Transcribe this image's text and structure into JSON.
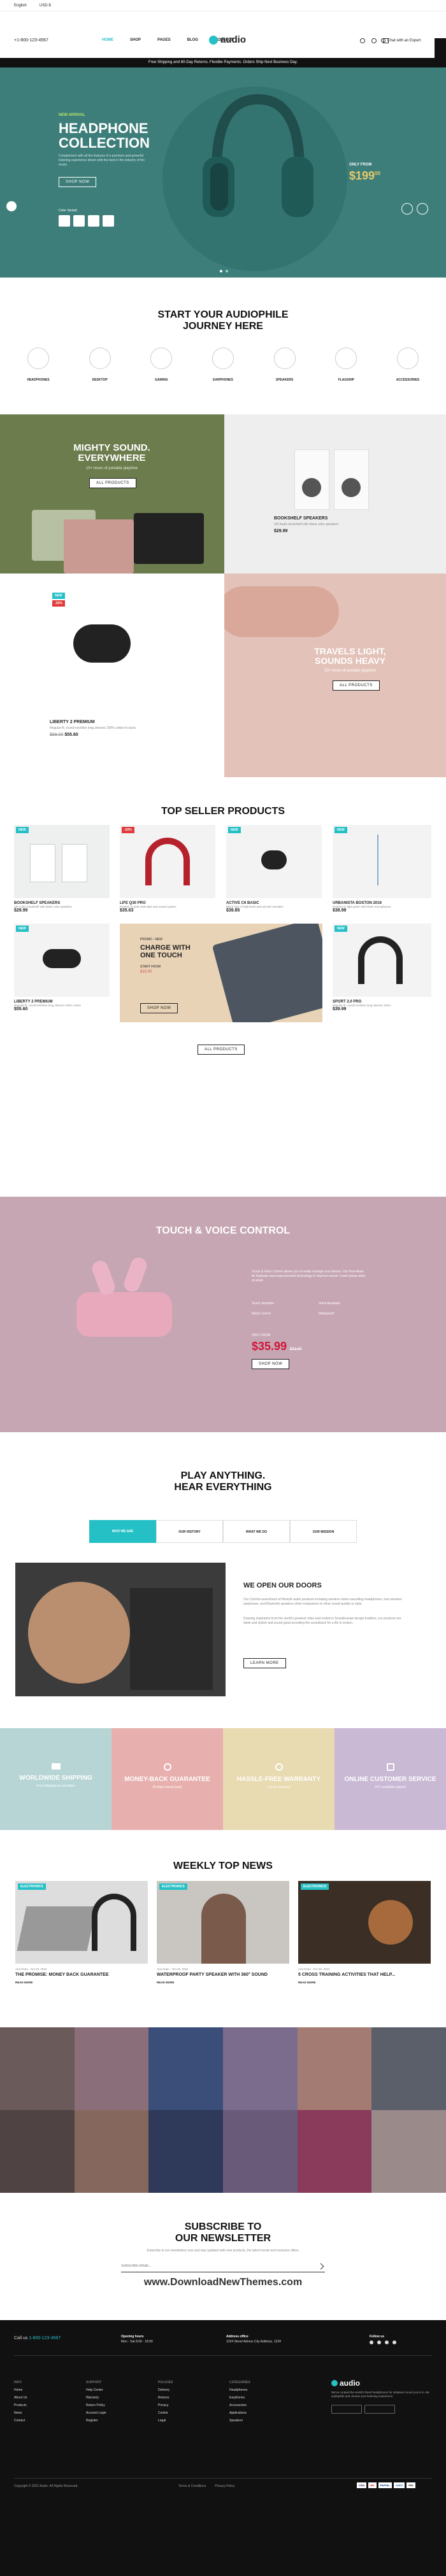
{
  "topbar": {
    "lang": "English",
    "currency": "USD $",
    "phone": "+1-800-123-4567",
    "chat": "Chat with an Expert"
  },
  "nav": {
    "items": [
      "HOME",
      "SHOP",
      "PAGES",
      "BLOG",
      "CONTACT"
    ],
    "logo": "audio"
  },
  "promo": "Free Shipping and 60-Day Returns. Flexible Payments. Orders Ship Next Business Day.",
  "hero": {
    "tag": "NEW ARRIVAL",
    "title_line1": "HEADPHONE",
    "title_line2": "COLLECTION",
    "desc": "Complement with all the features of a premium and powerful listening experience driven with the best in the industry of the music.",
    "cta": "SHOP NOW",
    "colors_label": "Color Variant",
    "price_label": "ONLY FROM",
    "price": "$199",
    "price_sup": "00"
  },
  "journey": {
    "title_line1": "START YOUR AUDIOPHILE",
    "title_line2": "JOURNEY HERE",
    "items": [
      "HEADPHONES",
      "DESKTOP",
      "GAMING",
      "EARPHONES",
      "SPEAKERS",
      "FLAGSHIP",
      "ACCESSORIES"
    ]
  },
  "banners": {
    "mighty": {
      "title_line1": "MIGHTY SOUND.",
      "title_line2": "EVERYWHERE",
      "sub": "10+ hours of portable playtime",
      "cta": "ALL PRODUCTS"
    },
    "bookshelf": {
      "name": "BOOKSHELF SPEAKERS",
      "desc": "UR Audio bookshelf with black color speakers",
      "price": "$29.99"
    },
    "liberty": {
      "badge_new": "NEW",
      "badge_sale": "-20%",
      "name": "LIBERTY 2 PREMIUM",
      "desc": "Regular fit, round-neckline long sleeves 100% cotton to sizes.",
      "old_price": "$69.00",
      "price": "$55.60"
    },
    "travels": {
      "title_line1": "TRAVELS LIGHT,",
      "title_line2": "SOUNDS HEAVY",
      "sub": "20+ hours of portable playtime",
      "cta": "ALL PRODUCTS"
    }
  },
  "top_seller": {
    "title": "TOP SELLER PRODUCTS",
    "products": [
      {
        "name": "BOOKSHELF SPEAKERS",
        "desc": "UR Audio bookshelf with black color speakers",
        "price": "$29.99",
        "badge": "NEW"
      },
      {
        "name": "LIFE Q30 PRO",
        "desc": "Printed on gold matt style and sound system",
        "price": "$35.63",
        "badge": "-20%"
      },
      {
        "name": "ACTIVE C6 BASIC",
        "desc": "Black type of high-level and smooth sensitive",
        "price": "$39.85",
        "badge": "NEW"
      },
      {
        "name": "URBANISTA BOSTON 2016",
        "desc": "Portland in light green with three microphones",
        "price": "$38.99",
        "badge": "NEW"
      },
      {
        "name": "LIBERTY 2 PREMIUM",
        "desc": "Regular fit, round-neckline long sleeves 100% cotton",
        "price": "$55.60",
        "badge": "NEW"
      },
      {
        "name": "SPORT 2.0 PRO",
        "desc": "Regular fit, round-neckline long sleeves 100%",
        "price": "$39.99",
        "badge": "NEW"
      }
    ],
    "charge": {
      "title_line1": "CHARGE WITH",
      "title_line2": "ONE TOUCH",
      "tag": "PROMO - NEW",
      "price_label": "START FROM",
      "price": "$15.00",
      "cta": "SHOP NOW"
    },
    "cta": "ALL PRODUCTS"
  },
  "touch": {
    "title": "TOUCH & VOICE CONTROL",
    "desc": "Touch & Voice Control allows you to easily manage your device. Our Pure-Bass for Earbuds uses bass-boosted technology to improve sound. Lorem ipsum dolor sit amet.",
    "features": [
      "Touch Sensitive",
      "Voice Assistant",
      "Noise Cancel",
      "Waterproof"
    ],
    "price_label": "ONLY FROM",
    "price": "$35.99",
    "old_price": "$42.00",
    "cta": "SHOP NOW"
  },
  "play": {
    "title_line1": "PLAY ANYTHING.",
    "title_line2": "HEAR EVERYTHING",
    "tabs": [
      "WHO WE ARE",
      "OUR HISTORY",
      "WHAT WE DO",
      "OUR MISSION"
    ],
    "heading": "WE OPEN OUR DOORS",
    "text1": "Our Colorful assortment of lifestyle audio products including wireless noise-cancelling headphones, true wireless earphones, and Bluetooth speakers short comparison to other sound quality or style.",
    "text2": "Drawing inspiration from the world's greatest cities and rooted in Scandinavian design tradition, our products are sleek and stylish and sound great providing the soundtrack for a life in motion.",
    "cta": "LEARN MORE"
  },
  "features": [
    {
      "title": "WORLDWIDE SHIPPING",
      "desc": "Free Shipping on all orders",
      "color": "#b8d5d5"
    },
    {
      "title": "MONEY-BACK GUARANTEE",
      "desc": "30 days money-back",
      "color": "#e7b0ae"
    },
    {
      "title": "HASSLE-FREE WARRANTY",
      "desc": "2 years warranty",
      "color": "#e8dab1"
    },
    {
      "title": "ONLINE CUSTOMER SERVICE",
      "desc": "24/7 available support",
      "color": "#c9b9d5"
    }
  ],
  "news": {
    "title": "WEEKLY TOP NEWS",
    "items": [
      {
        "cat": "ELECTRONICS",
        "meta": "Aria Khan  -  Oct 20, 2022",
        "title": "THE PROMISE: MONEY BACK GUARANTEE",
        "cta": "READ MORE"
      },
      {
        "cat": "ELECTRONICS",
        "meta": "Aria Khan  -  Oct 20, 2022",
        "title": "WATERPROOF PARTY SPEAKER WITH 360° SOUND",
        "cta": "READ MORE"
      },
      {
        "cat": "ELECTRONICS",
        "meta": "Aria Khan  -  Oct 20, 2022",
        "title": "5 CROSS TRAINING ACTIVITIES THAT HELP...",
        "cta": "READ MORE"
      }
    ]
  },
  "newsletter": {
    "title_line1": "SUBSCRIBE TO",
    "title_line2": "OUR NEWSLETTER",
    "sub": "Subscribe to our newsletters now and stay updated with new products, the latest trends and exclusive offers.",
    "placeholder": "Subscribe email...",
    "watermark": "www.DownloadNewThemes.com"
  },
  "footer": {
    "call_label": "Call us",
    "call_number": "1-800-123-4567",
    "hours_label": "Opening hours",
    "hours": "Mon - Sat 8:00 - 18:00",
    "address_label": "Address office",
    "address": "1234 Street Adress City Address, 1234",
    "follow_label": "Follow us",
    "col1_title": "INFO",
    "col1": [
      "Home",
      "About Us",
      "Products",
      "News",
      "Contact"
    ],
    "col2_title": "SUPPORT",
    "col2": [
      "Help Center",
      "Warranty",
      "Return Policy",
      "Account Login",
      "Register"
    ],
    "col3_title": "POLICIES",
    "col3": [
      "Delivery",
      "Returns",
      "Privacy",
      "Cookie",
      "Legal"
    ],
    "col4_title": "CATEGORIES",
    "col4": [
      "Headphones",
      "Earphones",
      "Accessories",
      "Applications",
      "Speakers"
    ],
    "brand": "audio",
    "about": "We've curated the world's finest headphones for whatever mood you're in. Be audiophile and choose your listening experience.",
    "copyright": "Copyright © 2022 Audio. All Rights Reserved.",
    "terms": "Terms & Conditions",
    "privacy": "Privacy Policy",
    "cards": [
      "VISA",
      "MC",
      "PAYPAL",
      "AMEX",
      "PAY"
    ]
  }
}
